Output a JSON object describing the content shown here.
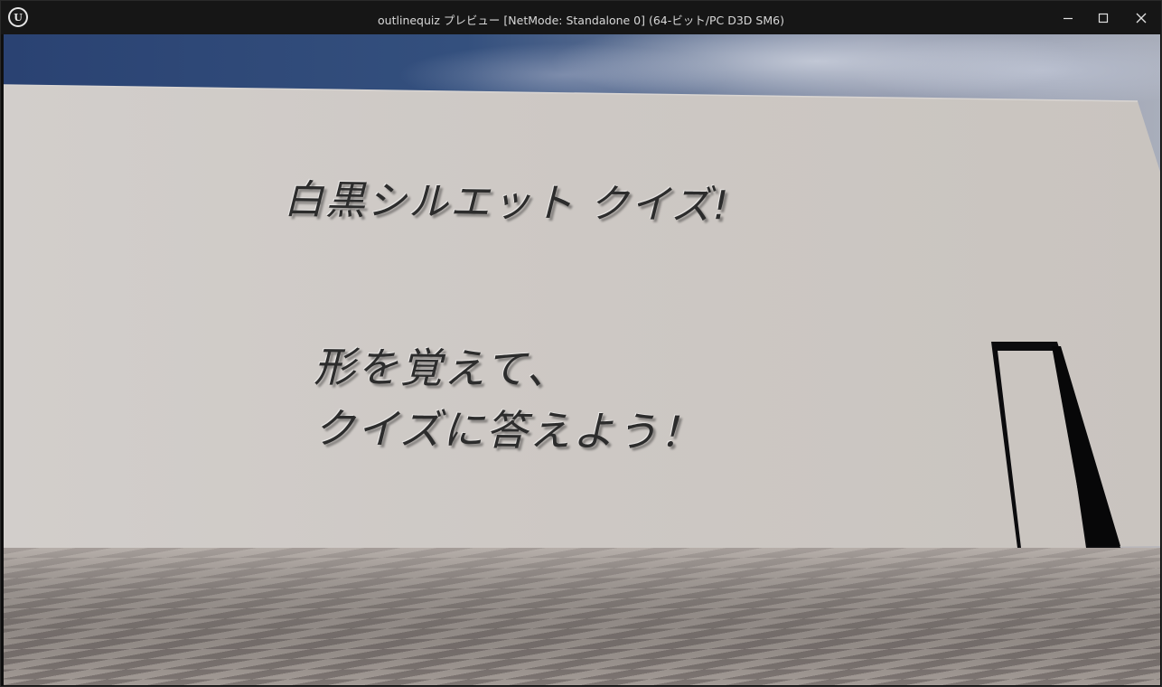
{
  "window": {
    "title": "outlinequiz プレビュー [NetMode: Standalone 0]  (64-ビット/PC D3D SM6)",
    "app_icon_letter": "U",
    "controls": {
      "minimize_icon": "minimize-icon",
      "maximize_icon": "maximize-icon",
      "close_icon": "close-icon"
    }
  },
  "scene": {
    "wall_title": "白黒シルエット クイズ!",
    "message_line1": "形を覚えて、",
    "message_line2": "クイズに答えよう！",
    "colors": {
      "wall": "#cfcac6",
      "floor_light": "#a19893",
      "floor_dark": "#7b7370",
      "text": "#2c2c2c",
      "door_frame": "#0b0b0d"
    }
  }
}
